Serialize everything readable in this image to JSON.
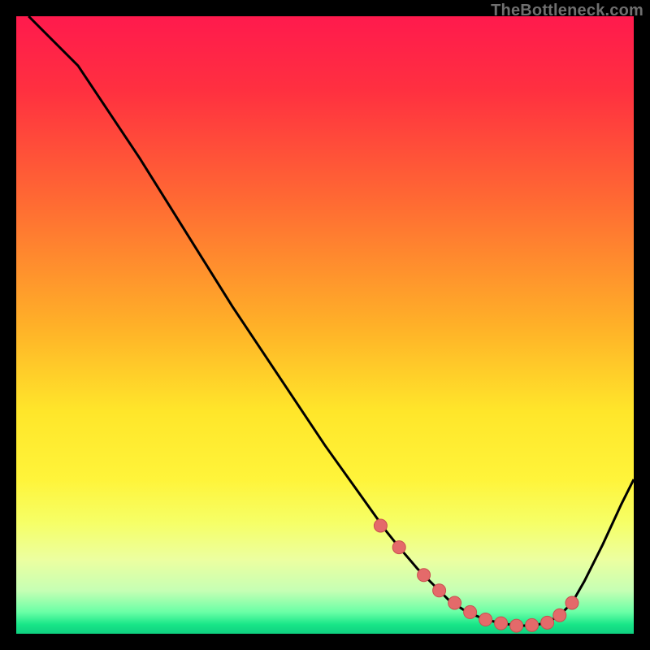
{
  "watermark": "TheBottleneck.com",
  "colors": {
    "black": "#000000",
    "curve": "#000000",
    "markerFill": "#e46a6a",
    "markerStroke": "#c94f4f",
    "gradientStops": [
      {
        "offset": 0.0,
        "color": "#ff1a4d"
      },
      {
        "offset": 0.12,
        "color": "#ff3040"
      },
      {
        "offset": 0.3,
        "color": "#ff6a33"
      },
      {
        "offset": 0.5,
        "color": "#ffb028"
      },
      {
        "offset": 0.64,
        "color": "#ffe62a"
      },
      {
        "offset": 0.75,
        "color": "#fff43a"
      },
      {
        "offset": 0.82,
        "color": "#f6ff66"
      },
      {
        "offset": 0.88,
        "color": "#ecffa0"
      },
      {
        "offset": 0.93,
        "color": "#c6ffb4"
      },
      {
        "offset": 0.965,
        "color": "#6affa6"
      },
      {
        "offset": 0.985,
        "color": "#18e688"
      },
      {
        "offset": 1.0,
        "color": "#0fd080"
      }
    ]
  },
  "chart_data": {
    "type": "line",
    "title": "",
    "xlabel": "",
    "ylabel": "",
    "xlim": [
      0,
      100
    ],
    "ylim": [
      0,
      100
    ],
    "series": [
      {
        "name": "curve",
        "x": [
          2,
          5,
          10,
          15,
          20,
          25,
          30,
          35,
          40,
          45,
          50,
          55,
          60,
          62,
          65,
          68,
          70,
          73,
          76,
          79,
          82,
          84,
          86,
          88,
          90,
          92,
          95,
          98,
          100
        ],
        "y": [
          100,
          97,
          92,
          84.5,
          77,
          69,
          61,
          53,
          45.5,
          38,
          30.5,
          23.5,
          16.5,
          14,
          10.5,
          7.5,
          5.5,
          3.5,
          2.3,
          1.6,
          1.3,
          1.4,
          1.8,
          3.0,
          5.0,
          8.5,
          14.5,
          21,
          25
        ]
      }
    ],
    "markers": {
      "name": "highlighted-points",
      "x": [
        59,
        62,
        66,
        68.5,
        71,
        73.5,
        76,
        78.5,
        81,
        83.5,
        86,
        88,
        90
      ],
      "y": [
        17.5,
        14,
        9.5,
        7,
        5,
        3.5,
        2.3,
        1.7,
        1.3,
        1.4,
        1.8,
        3.0,
        5.0
      ]
    }
  }
}
